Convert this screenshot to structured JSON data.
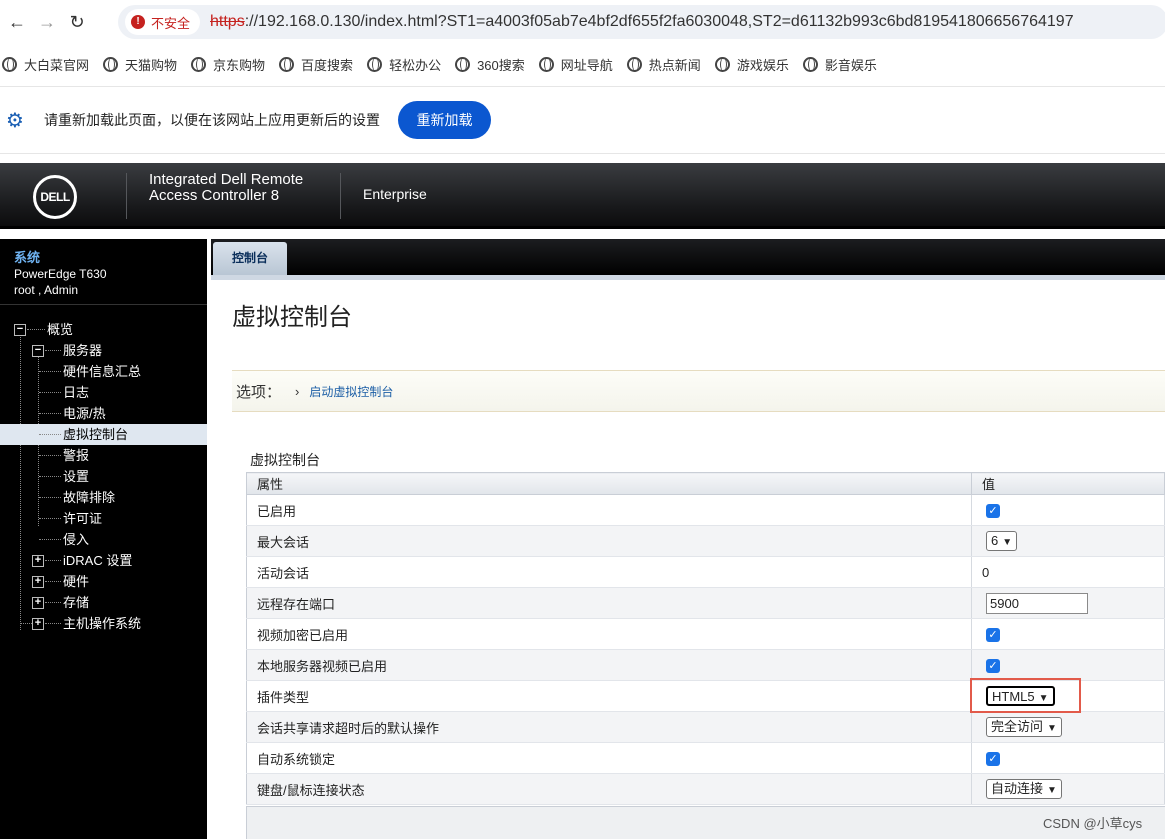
{
  "browser": {
    "insecure_label": "不安全",
    "url_scheme": "https",
    "url_rest": "://192.168.0.130/index.html?ST1=a4003f05ab7e4bf2df655f2fa6030048,ST2=d61132b993c6bd819541806656764197"
  },
  "bookmarks": [
    "大白菜官网",
    "天猫购物",
    "京东购物",
    "百度搜索",
    "轻松办公",
    "360搜索",
    "网址导航",
    "热点新闻",
    "游戏娱乐",
    "影音娱乐"
  ],
  "infobar": {
    "message": "请重新加载此页面，以便在该网站上应用更新后的设置",
    "reload_label": "重新加载"
  },
  "header": {
    "logo": "DELL",
    "product_line1": "Integrated Dell Remote",
    "product_line2": "Access Controller 8",
    "edition": "Enterprise"
  },
  "sidebar": {
    "title": "系统",
    "model": "PowerEdge T630",
    "user": "root , Admin",
    "tree": {
      "overview": "概览",
      "server": "服务器",
      "server_children": [
        "硬件信息汇总",
        "日志",
        "电源/热",
        "虚拟控制台",
        "警报",
        "设置",
        "故障排除",
        "许可证",
        "侵入"
      ],
      "others": [
        "iDRAC 设置",
        "硬件",
        "存储",
        "主机操作系统"
      ]
    }
  },
  "tabs": {
    "active": "控制台"
  },
  "main": {
    "page_title": "虚拟控制台",
    "options_label": "选项：",
    "options_link": "启动虚拟控制台",
    "section_title": "虚拟控制台",
    "table_headers": [
      "属性",
      "值"
    ],
    "rows": [
      {
        "label": "已启用",
        "type": "checkbox",
        "checked": true
      },
      {
        "label": "最大会话",
        "type": "select",
        "value": "6"
      },
      {
        "label": "活动会话",
        "type": "text",
        "value": "0"
      },
      {
        "label": "远程存在端口",
        "type": "input",
        "value": "5900"
      },
      {
        "label": "视频加密已启用",
        "type": "checkbox",
        "checked": true
      },
      {
        "label": "本地服务器视频已启用",
        "type": "checkbox",
        "checked": true
      },
      {
        "label": "插件类型",
        "type": "select",
        "value": "HTML5"
      },
      {
        "label": "会话共享请求超时后的默认操作",
        "type": "select",
        "value": "完全访问"
      },
      {
        "label": "自动系统锁定",
        "type": "checkbox",
        "checked": true
      },
      {
        "label": "键盘/鼠标连接状态",
        "type": "select",
        "value": "自动连接"
      }
    ]
  },
  "watermark": "CSDN @小草cys"
}
